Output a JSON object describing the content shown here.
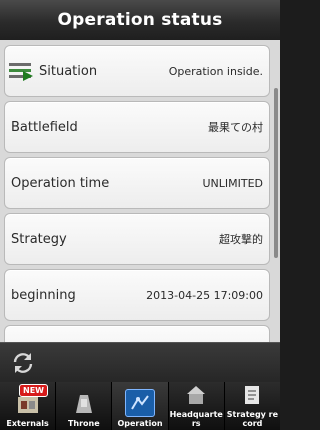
{
  "header": {
    "title": "Operation status"
  },
  "rows": [
    {
      "label": "Situation",
      "value": "Operation inside."
    },
    {
      "label": "Battlefield",
      "value": "最果ての村"
    },
    {
      "label": "Operation time",
      "value": "UNLIMITED"
    },
    {
      "label": "Strategy",
      "value": "超攻撃的"
    },
    {
      "label": "beginning",
      "value": "2013-04-25 17:09:00"
    }
  ],
  "refresh": {
    "icon": "refresh-icon"
  },
  "tabs": [
    {
      "label": "Externals",
      "icon": "externals-icon",
      "badge": "NEW"
    },
    {
      "label": "Throne",
      "icon": "throne-icon"
    },
    {
      "label": "Operation",
      "icon": "operation-icon",
      "active": true
    },
    {
      "label": "Headquarters",
      "icon": "headquarters-icon"
    },
    {
      "label": "Strategy record",
      "icon": "strategy-record-icon"
    }
  ],
  "colors": {
    "accent": "#1a5ea8",
    "badge": "#d61a1a"
  }
}
